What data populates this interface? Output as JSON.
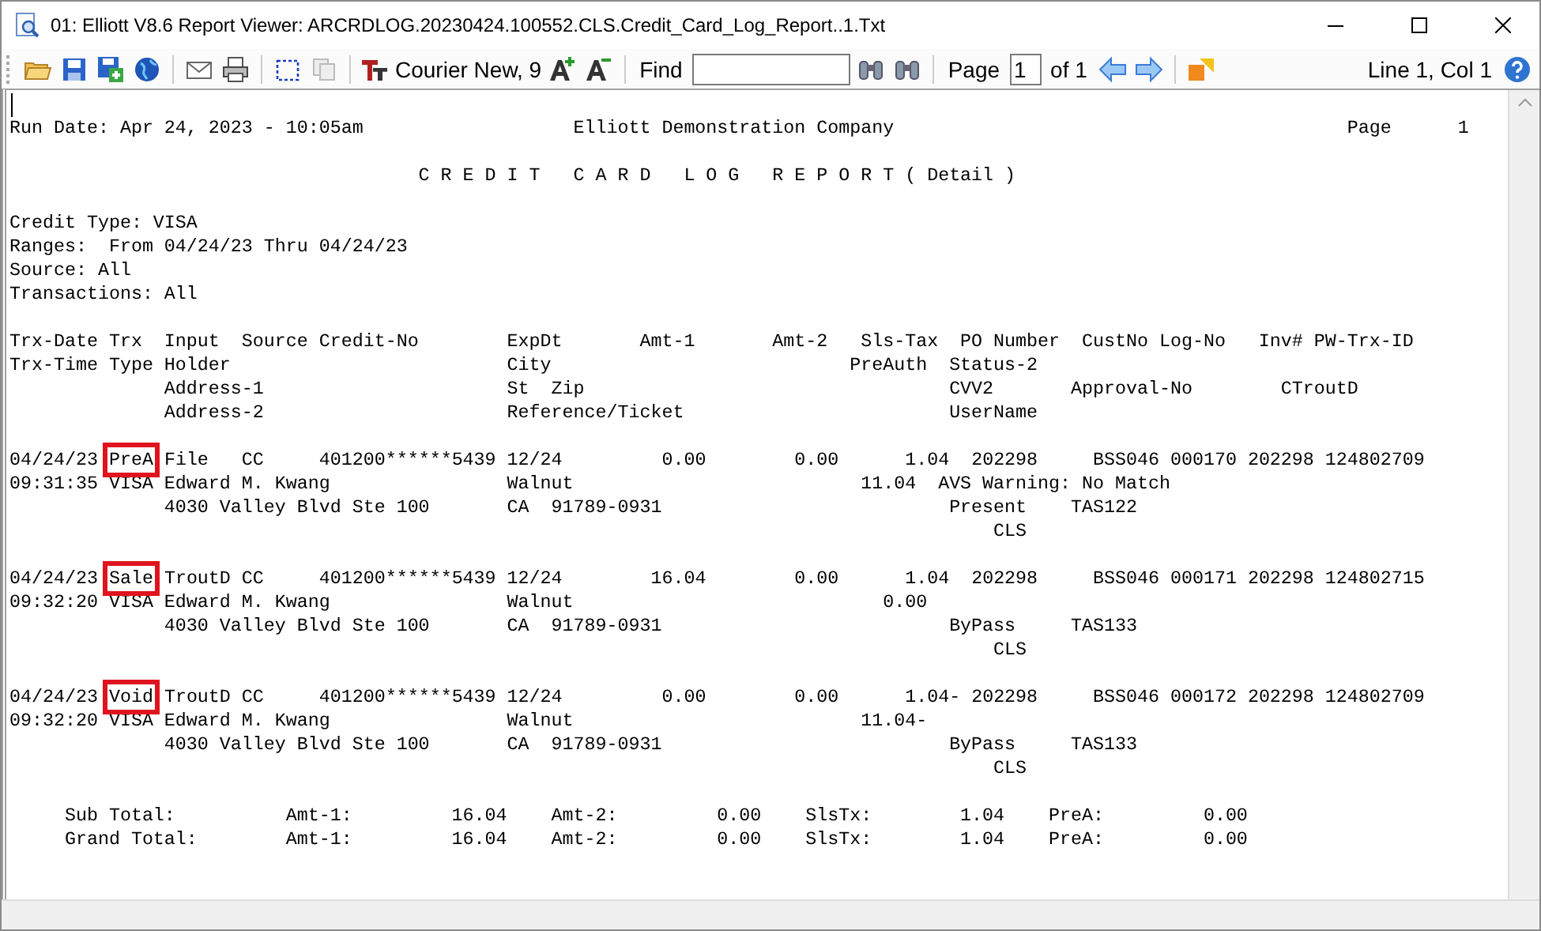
{
  "window": {
    "title": "01: Elliott V8.6 Report Viewer: ARCRDLOG.20230424.100552.CLS.Credit_Card_Log_Report..1.Txt"
  },
  "toolbar": {
    "font": "Courier New, 9",
    "find_label": "Find",
    "page_label": "Page",
    "page": "1",
    "page_count": "of 1",
    "position": "Line 1, Col 1"
  },
  "report": {
    "blocks": [
      [
        {
          "kind": "plain",
          "text": "Run Date: Apr 24, 2023 - 10:05am                   Elliott Demonstration Company                                         Page      1"
        }
      ],
      [
        {
          "kind": "plain",
          "text": "                                     C R E D I T   C A R D   L O G   R E P O R T ( Detail )"
        }
      ],
      [
        {
          "kind": "plain",
          "text": "Credit Type: VISA"
        },
        {
          "kind": "plain",
          "text": "Ranges:  From 04/24/23 Thru 04/24/23"
        },
        {
          "kind": "plain",
          "text": "Source: All"
        },
        {
          "kind": "plain",
          "text": "Transactions: All"
        }
      ],
      [
        {
          "kind": "plain",
          "text": "Trx-Date Trx  Input  Source Credit-No        ExpDt       Amt-1       Amt-2   Sls-Tax  PO Number  CustNo Log-No   Inv# PW-Trx-ID"
        },
        {
          "kind": "plain",
          "text": "Trx-Time Type Holder                         City                           PreAuth  Status-2"
        },
        {
          "kind": "plain",
          "text": "              Address-1                      St  Zip                                 CVV2       Approval-No        CTroutD"
        },
        {
          "kind": "plain",
          "text": "              Address-2                      Reference/Ticket                        UserName"
        }
      ],
      [
        {
          "kind": "marked",
          "parts": [
            {
              "text": "04/24/23 ",
              "boxed": false
            },
            {
              "text": "PreA",
              "boxed": true
            },
            {
              "text": " File   CC     401200******5439 12/24         0.00        0.00      1.04  202298     BSS046 000170 202298 124802709",
              "boxed": false
            }
          ]
        },
        {
          "kind": "plain",
          "text": "09:31:35 VISA Edward M. Kwang                Walnut                          11.04  AVS Warning: No Match"
        },
        {
          "kind": "plain",
          "text": "              4030 Valley Blvd Ste 100       CA  91789-0931                          Present    TAS122"
        },
        {
          "kind": "plain",
          "text": "                                                                                         CLS"
        }
      ],
      [
        {
          "kind": "marked",
          "parts": [
            {
              "text": "04/24/23 ",
              "boxed": false
            },
            {
              "text": "Sale",
              "boxed": true
            },
            {
              "text": " TroutD CC     401200******5439 12/24        16.04        0.00      1.04  202298     BSS046 000171 202298 124802715",
              "boxed": false
            }
          ]
        },
        {
          "kind": "plain",
          "text": "09:32:20 VISA Edward M. Kwang                Walnut                            0.00"
        },
        {
          "kind": "plain",
          "text": "              4030 Valley Blvd Ste 100       CA  91789-0931                          ByPass     TAS133"
        },
        {
          "kind": "plain",
          "text": "                                                                                         CLS"
        }
      ],
      [
        {
          "kind": "marked",
          "parts": [
            {
              "text": "04/24/23 ",
              "boxed": false
            },
            {
              "text": "Void",
              "boxed": true
            },
            {
              "text": " TroutD CC     401200******5439 12/24         0.00        0.00      1.04- 202298     BSS046 000172 202298 124802709",
              "boxed": false
            }
          ]
        },
        {
          "kind": "plain",
          "text": "09:32:20 VISA Edward M. Kwang                Walnut                          11.04-"
        },
        {
          "kind": "plain",
          "text": "              4030 Valley Blvd Ste 100       CA  91789-0931                          ByPass     TAS133"
        },
        {
          "kind": "plain",
          "text": "                                                                                         CLS"
        }
      ],
      [
        {
          "kind": "plain",
          "text": "     Sub Total:          Amt-1:         16.04    Amt-2:         0.00    SlsTx:        1.04    PreA:         0.00"
        },
        {
          "kind": "plain",
          "text": "     Grand Total:        Amt-1:         16.04    Amt-2:         0.00    SlsTx:        1.04    PreA:         0.00"
        }
      ]
    ]
  }
}
